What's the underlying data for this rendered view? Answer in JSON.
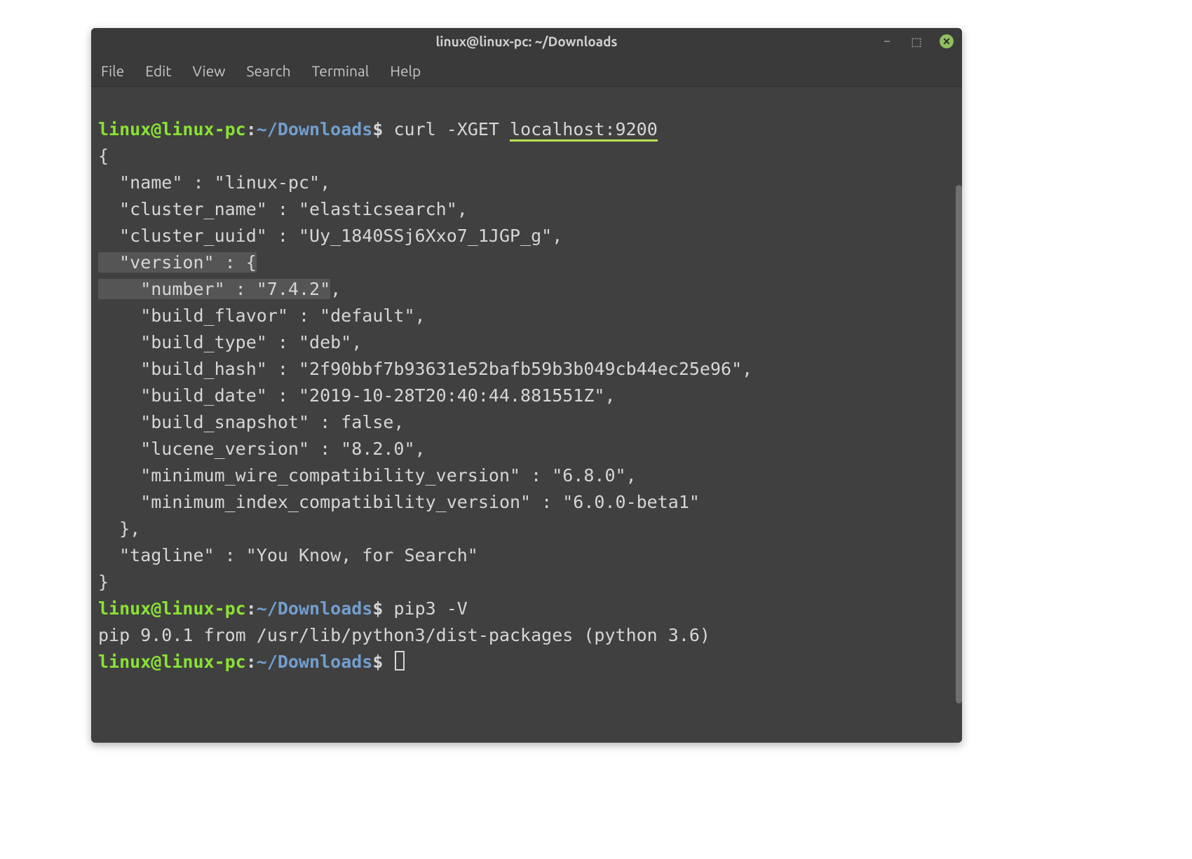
{
  "window": {
    "title": "linux@linux-pc: ~/Downloads"
  },
  "menubar": {
    "items": [
      "File",
      "Edit",
      "View",
      "Search",
      "Terminal",
      "Help"
    ]
  },
  "prompt": {
    "user_host": "linux@linux-pc",
    "colon": ":",
    "path": "~/Downloads",
    "dollar": "$"
  },
  "commands": {
    "cmd1_prefix": " curl -XGET ",
    "cmd1_target": "localhost:9200",
    "cmd2": " pip3 -V"
  },
  "output": {
    "line1": "{",
    "line2": "  \"name\" : \"linux-pc\",",
    "line3": "  \"cluster_name\" : \"elasticsearch\",",
    "line4": "  \"cluster_uuid\" : \"Uy_1840SSj6Xxo7_1JGP_g\",",
    "line5a": "  \"version\" : {",
    "line6a": "    \"number\" : \"7.4.2\"",
    "line6b": ",",
    "line7": "    \"build_flavor\" : \"default\",",
    "line8": "    \"build_type\" : \"deb\",",
    "line9": "    \"build_hash\" : \"2f90bbf7b93631e52bafb59b3b049cb44ec25e96\",",
    "line10": "    \"build_date\" : \"2019-10-28T20:40:44.881551Z\",",
    "line11": "    \"build_snapshot\" : false,",
    "line12": "    \"lucene_version\" : \"8.2.0\",",
    "line13": "    \"minimum_wire_compatibility_version\" : \"6.8.0\",",
    "line14": "    \"minimum_index_compatibility_version\" : \"6.0.0-beta1\"",
    "line15": "  },",
    "line16": "  \"tagline\" : \"You Know, for Search\"",
    "line17": "}",
    "pip_out": "pip 9.0.1 from /usr/lib/python3/dist-packages (python 3.6)"
  },
  "icons": {
    "minimize": "–",
    "maximize": "⬚",
    "close": "✕"
  }
}
